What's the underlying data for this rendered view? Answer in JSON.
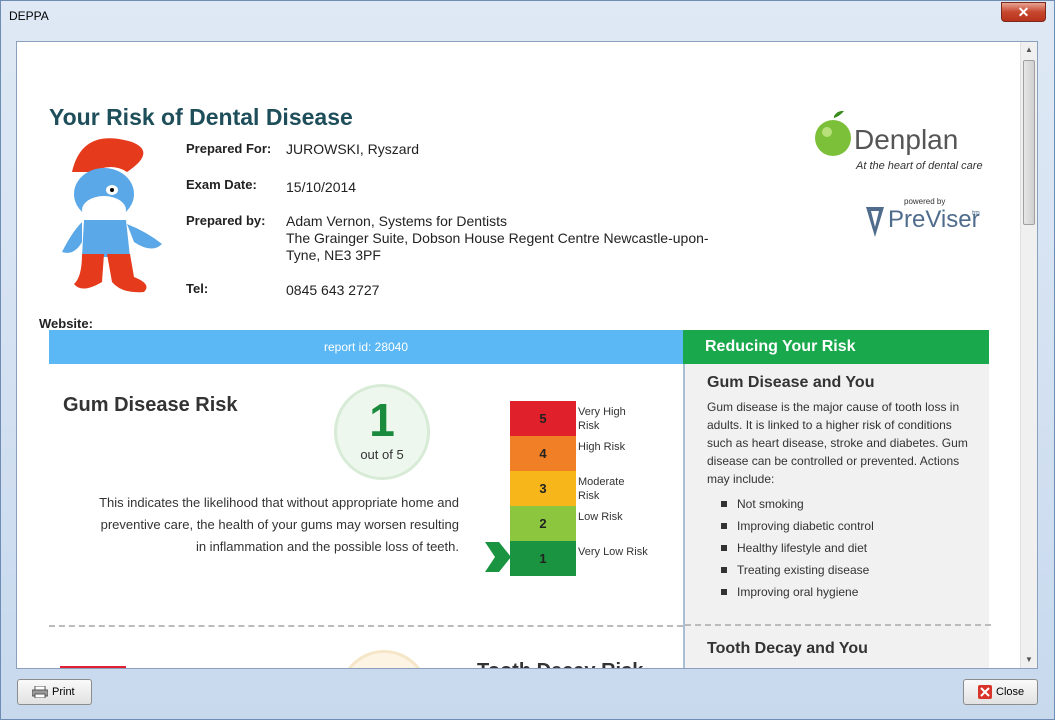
{
  "window": {
    "title": "DEPPA",
    "close_glyph": "✕"
  },
  "report": {
    "title": "Your Risk of Dental Disease",
    "prepared_for_label": "Prepared For:",
    "prepared_for": "JUROWSKI, Ryszard",
    "exam_date_label": "Exam Date:",
    "exam_date": "15/10/2014",
    "prepared_by_label": "Prepared by:",
    "prepared_by_line1": "Adam Vernon, Systems for Dentists",
    "prepared_by_line2": "The Grainger Suite, Dobson House Regent Centre Newcastle-upon-Tyne, NE3 3PF",
    "tel_label": "Tel:",
    "tel": "0845 643 2727",
    "website_label": "Website:",
    "report_id": "report id: 28040"
  },
  "logos": {
    "denplan": "Denplan",
    "denplan_tagline": "At the heart of dental care",
    "previser_powered": "powered by",
    "previser": "PreViser",
    "previser_tm": "tm"
  },
  "gum": {
    "title": "Gum Disease Risk",
    "score": "1",
    "score_of": "out of 5",
    "description": "This indicates the likelihood that without appropriate home and preventive care, the health of your gums may worsen resulting in inflammation and the possible loss of teeth."
  },
  "risk_scale": [
    {
      "level": "5",
      "label": "Very High Risk",
      "color": "#e0202a"
    },
    {
      "level": "4",
      "label": "High Risk",
      "color": "#f07f25"
    },
    {
      "level": "3",
      "label": "Moderate Risk",
      "color": "#f7b71b"
    },
    {
      "level": "2",
      "label": "Low Risk",
      "color": "#8cc63f"
    },
    {
      "level": "1",
      "label": "Very Low Risk",
      "color": "#1a9440"
    }
  ],
  "side": {
    "header": "Reducing Your Risk",
    "gum_title": "Gum Disease and You",
    "gum_text": "Gum disease is the major cause of tooth loss in adults. It is linked to a higher risk of conditions such as heart disease, stroke and diabetes. Gum disease can be controlled or prevented. Actions may include:",
    "actions": [
      "Not smoking",
      "Improving diabetic control",
      "Healthy lifestyle and diet",
      "Treating existing disease",
      "Improving oral hygiene"
    ],
    "tooth_title": "Tooth Decay and You"
  },
  "tooth": {
    "title": "Tooth Decay Risk"
  },
  "buttons": {
    "print": "Print",
    "close": "Close"
  },
  "colors": {
    "accent_blue": "#5bb8f5",
    "accent_green": "#1aa84d",
    "title_teal": "#1d4e5a"
  },
  "icons": [
    "close-icon",
    "printer-icon",
    "apple-icon",
    "previser-icon",
    "arrow-right-icon",
    "scroll-up-icon",
    "scroll-down-icon"
  ]
}
